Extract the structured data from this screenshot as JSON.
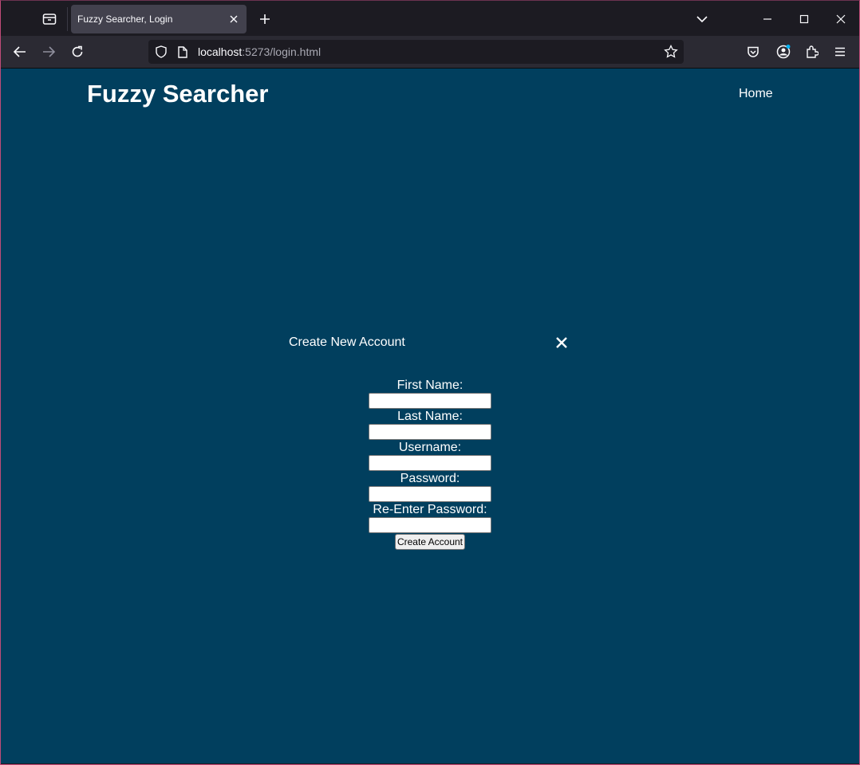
{
  "browser": {
    "tab_title": "Fuzzy Searcher, Login",
    "url_host": "localhost",
    "url_rest": ":5273/login.html"
  },
  "site": {
    "brand": "Fuzzy Searcher",
    "nav_home": "Home"
  },
  "modal": {
    "title": "Create New Account",
    "fields": {
      "first_name": "First Name:",
      "last_name": "Last Name:",
      "username": "Username:",
      "password": "Password:",
      "reenter_password": "Re-Enter Password:"
    },
    "submit_label": "Create Account"
  },
  "colors": {
    "page_bg": "#013f5e",
    "tab_bg": "#42414d",
    "toolbar_bg": "#2b2a33"
  }
}
